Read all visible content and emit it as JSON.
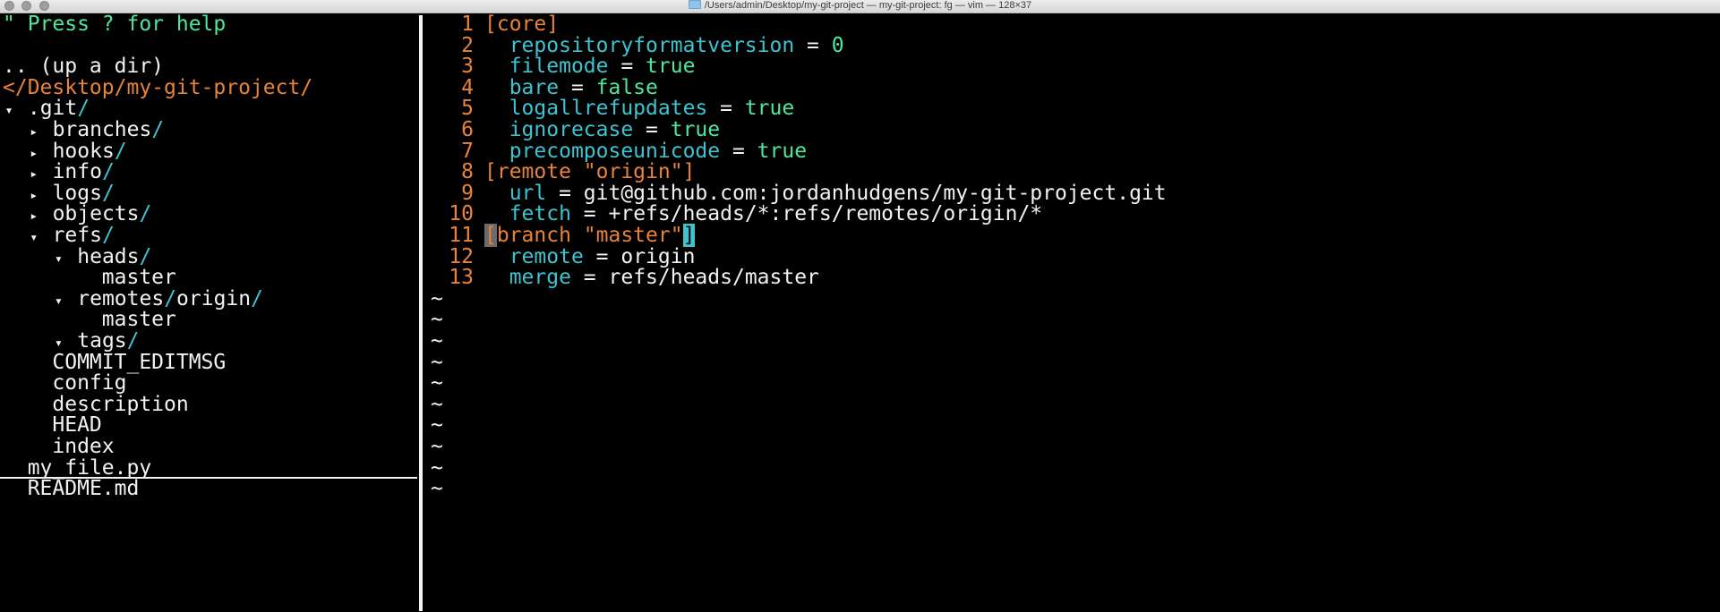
{
  "window": {
    "title": "/Users/admin/Desktop/my-git-project —  my-git-project: fg  — vim — 128×37"
  },
  "tree": {
    "help": "\" Press ? for help",
    "up": ".. (up a dir)",
    "root": "</Desktop/my-git-project/",
    "items": [
      {
        "indent": "",
        "arrow": "▾",
        "name": ".git",
        "slash": "/"
      },
      {
        "indent": "  ",
        "arrow": "▸",
        "name": "branches",
        "slash": "/"
      },
      {
        "indent": "  ",
        "arrow": "▸",
        "name": "hooks",
        "slash": "/"
      },
      {
        "indent": "  ",
        "arrow": "▸",
        "name": "info",
        "slash": "/"
      },
      {
        "indent": "  ",
        "arrow": "▸",
        "name": "logs",
        "slash": "/"
      },
      {
        "indent": "  ",
        "arrow": "▸",
        "name": "objects",
        "slash": "/"
      },
      {
        "indent": "  ",
        "arrow": "▾",
        "name": "refs",
        "slash": "/"
      },
      {
        "indent": "    ",
        "arrow": "▾",
        "name": "heads",
        "slash": "/"
      },
      {
        "indent": "        ",
        "arrow": "",
        "name": "master",
        "slash": ""
      },
      {
        "indent": "    ",
        "arrow": "▾",
        "name": "remotes/origin",
        "slash": "/"
      },
      {
        "indent": "        ",
        "arrow": "",
        "name": "master",
        "slash": ""
      },
      {
        "indent": "    ",
        "arrow": "▾",
        "name": "tags",
        "slash": "/"
      },
      {
        "indent": "    ",
        "arrow": "",
        "name": "COMMIT_EDITMSG",
        "slash": ""
      },
      {
        "indent": "    ",
        "arrow": "",
        "name": "config",
        "slash": ""
      },
      {
        "indent": "    ",
        "arrow": "",
        "name": "description",
        "slash": ""
      },
      {
        "indent": "    ",
        "arrow": "",
        "name": "HEAD",
        "slash": ""
      },
      {
        "indent": "    ",
        "arrow": "",
        "name": "index",
        "slash": ""
      },
      {
        "indent": "  ",
        "arrow": "",
        "name": "my_file.py",
        "slash": ""
      },
      {
        "indent": "  ",
        "arrow": "",
        "name": "README.md",
        "slash": ""
      }
    ]
  },
  "editor": {
    "lines": [
      {
        "num": "1",
        "section": "[core]"
      },
      {
        "num": "2",
        "key": "repositoryformatversion",
        "eq": " = ",
        "value": "0",
        "value_color": "green"
      },
      {
        "num": "3",
        "key": "filemode",
        "eq": " = ",
        "value": "true",
        "value_color": "green"
      },
      {
        "num": "4",
        "key": "bare",
        "eq": " = ",
        "value": "false",
        "value_color": "green"
      },
      {
        "num": "5",
        "key": "logallrefupdates",
        "eq": " = ",
        "value": "true",
        "value_color": "green"
      },
      {
        "num": "6",
        "key": "ignorecase",
        "eq": " = ",
        "value": "true",
        "value_color": "green"
      },
      {
        "num": "7",
        "key": "precomposeunicode",
        "eq": " = ",
        "value": "true",
        "value_color": "green"
      },
      {
        "num": "8",
        "section": "[remote \"origin\"]"
      },
      {
        "num": "9",
        "key": "url",
        "eq": " = ",
        "value": "git@github.com:jordanhudgens/my-git-project.git",
        "value_color": "white"
      },
      {
        "num": "10",
        "key": "fetch",
        "eq": " = ",
        "value": "+refs/heads/*:refs/remotes/origin/*",
        "value_color": "white"
      },
      {
        "num": "11",
        "section_open": "[",
        "section_mid": "branch \"master\"",
        "section_close": "]"
      },
      {
        "num": "12",
        "key": "remote",
        "eq": " = ",
        "value": "origin",
        "value_color": "white"
      },
      {
        "num": "13",
        "key": "merge",
        "eq": " = ",
        "value": "refs/heads/master",
        "value_color": "white"
      }
    ],
    "empty_marker": "~",
    "empty_count": 10
  },
  "colors": {
    "background": "#000000",
    "orange": "#e8833a",
    "cyan": "#3ec3cf",
    "green": "#4fe79d",
    "text": "#f2f2f2"
  }
}
